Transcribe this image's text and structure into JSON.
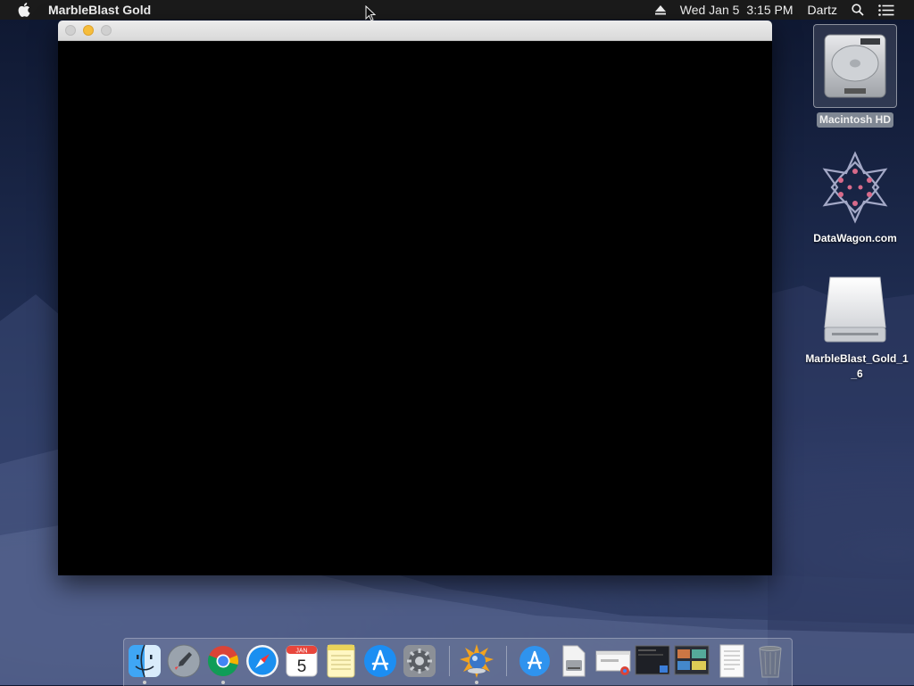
{
  "menubar": {
    "app_name": "MarbleBlast Gold",
    "date": "Wed Jan 5",
    "time": "3:15 PM",
    "user": "Dartz"
  },
  "window": {
    "title": ""
  },
  "desktop_icons": [
    {
      "label": "Macintosh HD",
      "icon": "hard-drive-icon",
      "selected": true
    },
    {
      "label": "DataWagon.com",
      "icon": "datawagon-logo-icon",
      "selected": false
    },
    {
      "label": "MarbleBlast_Gold_1_6",
      "icon": "disk-image-icon",
      "selected": false
    }
  ],
  "dock": {
    "items": [
      {
        "name": "finder",
        "icon": "finder-icon",
        "running": true
      },
      {
        "name": "launchpad",
        "icon": "launchpad-icon",
        "running": false
      },
      {
        "name": "chrome",
        "icon": "chrome-icon",
        "running": true
      },
      {
        "name": "safari",
        "icon": "safari-icon",
        "running": false
      },
      {
        "name": "calendar",
        "icon": "calendar-icon",
        "running": false
      },
      {
        "name": "notes",
        "icon": "notes-icon",
        "running": false
      },
      {
        "name": "app-store",
        "icon": "app-store-icon",
        "running": false
      },
      {
        "name": "system-preferences",
        "icon": "gear-icon",
        "running": false
      },
      {
        "name": "marbleblast",
        "icon": "marbleblast-icon",
        "running": true
      },
      {
        "name": "applications-folder",
        "icon": "app-store-icon",
        "running": false
      },
      {
        "name": "disk-image",
        "icon": "disk-image-icon",
        "running": false
      },
      {
        "name": "chrome-window",
        "icon": "chrome-window-icon",
        "running": false
      },
      {
        "name": "screenshot-1",
        "icon": "screenshot-icon",
        "running": false
      },
      {
        "name": "screenshot-2",
        "icon": "screenshot-icon",
        "running": false
      },
      {
        "name": "document",
        "icon": "document-icon",
        "running": false
      },
      {
        "name": "trash",
        "icon": "trash-icon",
        "running": false
      }
    ],
    "calendar_month": "JAN",
    "calendar_day": "5"
  }
}
